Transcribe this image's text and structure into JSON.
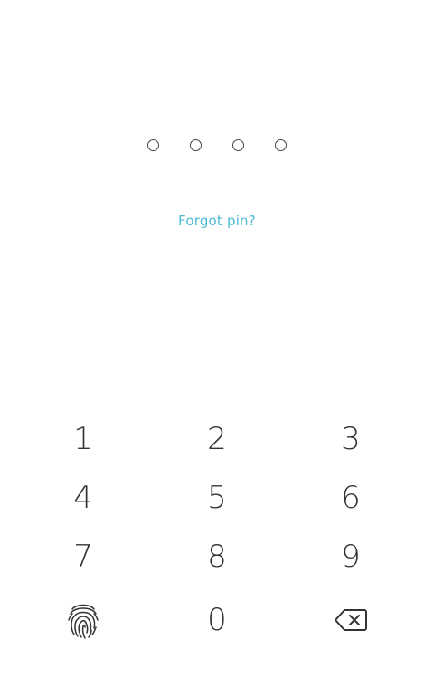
{
  "pin": {
    "length": 4,
    "entered": 0
  },
  "forgot_label": "Forgot pin?",
  "keypad": {
    "keys": [
      "1",
      "2",
      "3",
      "4",
      "5",
      "6",
      "7",
      "8",
      "9",
      "0"
    ],
    "fingerprint_icon": "fingerprint-icon",
    "backspace_icon": "backspace-icon"
  },
  "colors": {
    "accent": "#4dbcd4",
    "text": "#333333"
  }
}
